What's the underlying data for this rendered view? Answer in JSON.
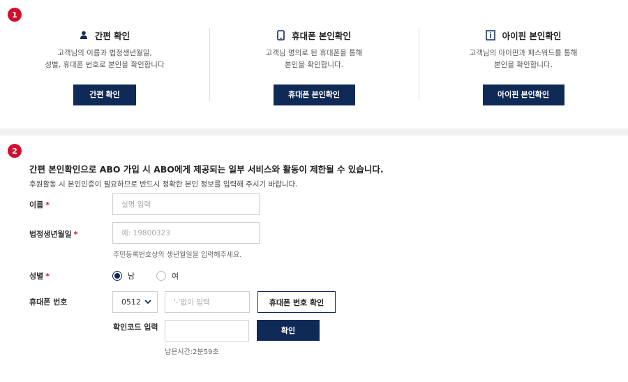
{
  "steps": {
    "one": "1",
    "two": "2"
  },
  "methods": [
    {
      "icon": "person-icon",
      "title": "간편 확인",
      "desc": "고객님의 이름과 법정생년월일,\n성별, 휴대폰 번호로 본인을 확인합니다",
      "button": "간편 확인"
    },
    {
      "icon": "phone-icon",
      "title": "휴대폰 본인확인",
      "desc": "고객님 명의로 된 휴대폰을 통해\n본인을 확인합니다.",
      "button": "휴대폰 본인확인"
    },
    {
      "icon": "info-icon",
      "title": "아이핀 본인확인",
      "desc": "고객님의 아이핀과 패스워드를 통해\n본인을 확인합니다.",
      "button": "아이핀 본인확인"
    }
  ],
  "notice": {
    "title": "간편 본인확인으로 ABO 가입 시 ABO에게 제공되는 일부 서비스와 활동이 제한될 수 있습니다.",
    "subtitle": "후원활동 시 본인인증이 필요하므로 반드시 정확한 본인 정보를 입력해 주시기 바랍니다."
  },
  "form": {
    "name": {
      "label": "이름",
      "required_mark": "*",
      "placeholder": "실명 입력",
      "value": ""
    },
    "birth": {
      "label": "법정생년월일",
      "required_mark": "*",
      "placeholder": "예: 19800323",
      "value": "",
      "help": "주민등록번호상의 생년월일을 입력해주세요."
    },
    "gender": {
      "label": "성별",
      "required_mark": "*",
      "options": [
        "남",
        "여"
      ],
      "selected": "남"
    },
    "phone": {
      "label": "휴대폰 번호",
      "prefix_selected": "0512",
      "placeholder": "'-'없이 입력",
      "value": "",
      "verify_button": "휴대폰 번호 확인"
    },
    "code": {
      "label": "확인코드 입력",
      "value": "",
      "confirm_button": "확인",
      "timer": "남은시간:2분59초"
    }
  },
  "colors": {
    "accent": "#d0102f",
    "navy": "#0f2a56",
    "band": "#f1f1f1"
  }
}
